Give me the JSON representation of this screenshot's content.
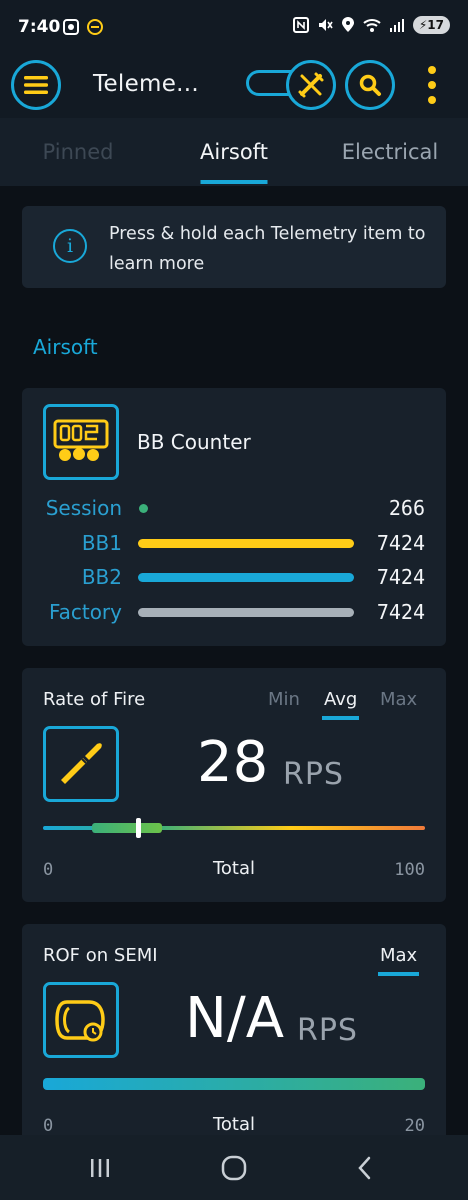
{
  "status_bar": {
    "time": "7:40",
    "battery": "17"
  },
  "app_bar": {
    "title": "Teleme..."
  },
  "tabs": [
    {
      "label": "Pinned",
      "state": "dim"
    },
    {
      "label": "Airsoft",
      "state": "active"
    },
    {
      "label": "Electrical",
      "state": "muted"
    }
  ],
  "info_banner": {
    "text": "Press & hold each Telemetry item to learn more"
  },
  "section": {
    "title": "Airsoft"
  },
  "bb_counter": {
    "title": "BB Counter",
    "rows": [
      {
        "label": "Session",
        "value": "266"
      },
      {
        "label": "BB1",
        "value": "7424"
      },
      {
        "label": "BB2",
        "value": "7424"
      },
      {
        "label": "Factory",
        "value": "7424"
      }
    ]
  },
  "rate_of_fire": {
    "title": "Rate of Fire",
    "modes": [
      "Min",
      "Avg",
      "Max"
    ],
    "selected_mode": "Avg",
    "value": "28",
    "unit": "RPS",
    "scale_min": "0",
    "scale_label": "Total",
    "scale_max": "100",
    "slider_level_percent": 25
  },
  "rof_semi": {
    "title": "ROF on SEMI",
    "mode": "Max",
    "value": "N/A",
    "unit": "RPS",
    "scale_min": "0",
    "scale_label": "Total",
    "scale_max": "20"
  },
  "colors": {
    "accent_blue": "#19a8d8",
    "accent_yellow": "#ffcc17",
    "session_dot": "#3bb07a",
    "bar_gray": "#a7b0b8",
    "background": "#0c1117",
    "card": "#18212b"
  },
  "icons": {
    "menu": "hamburger-menu-icon",
    "toggle_tool": "crossed-tools-icon",
    "search": "search-icon",
    "more": "more-vertical-icon",
    "info": "info-icon",
    "bb_counter": "bb-counter-icon",
    "rof": "bullet-icon",
    "semi": "semi-fire-icon"
  }
}
